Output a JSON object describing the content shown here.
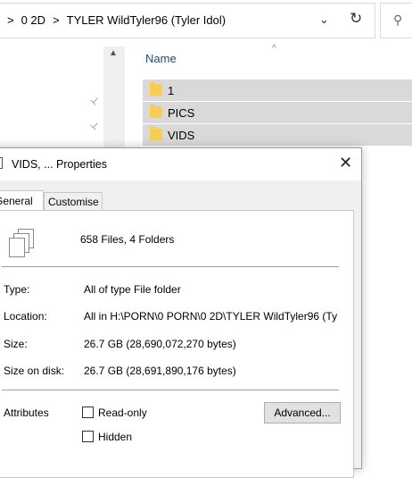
{
  "explorer": {
    "breadcrumb": [
      ">",
      "0 2D",
      ">",
      "TYLER WildTyler96 (Tyler Idol)"
    ],
    "chevron_glyph": "⌄",
    "refresh_glyph": "↻",
    "search_glyph": "⚲",
    "column_name": "Name",
    "sort_glyph": "^",
    "scroll_up_glyph": "▲",
    "pin_glyph": "📌",
    "files": [
      {
        "name": "1"
      },
      {
        "name": "PICS"
      },
      {
        "name": "VIDS"
      }
    ]
  },
  "dialog": {
    "title": "VIDS, ... Properties",
    "close_glyph": "✕",
    "tabs": [
      {
        "label": "General"
      },
      {
        "label": "Customise"
      }
    ],
    "summary": "658 Files, 4 Folders",
    "properties": [
      {
        "label": "Type:",
        "value": "All of type File folder"
      },
      {
        "label": "Location:",
        "value": "All in H:\\PORN\\0 PORN\\0 2D\\TYLER WildTyler96 (Ty"
      },
      {
        "label": "Size:",
        "value": "26.7 GB (28,690,072,270 bytes)"
      },
      {
        "label": "Size on disk:",
        "value": "26.7 GB (28,691,890,176 bytes)"
      }
    ],
    "attributes_label": "Attributes",
    "readonly_label": "Read-only",
    "hidden_label": "Hidden",
    "advanced_label": "Advanced..."
  }
}
